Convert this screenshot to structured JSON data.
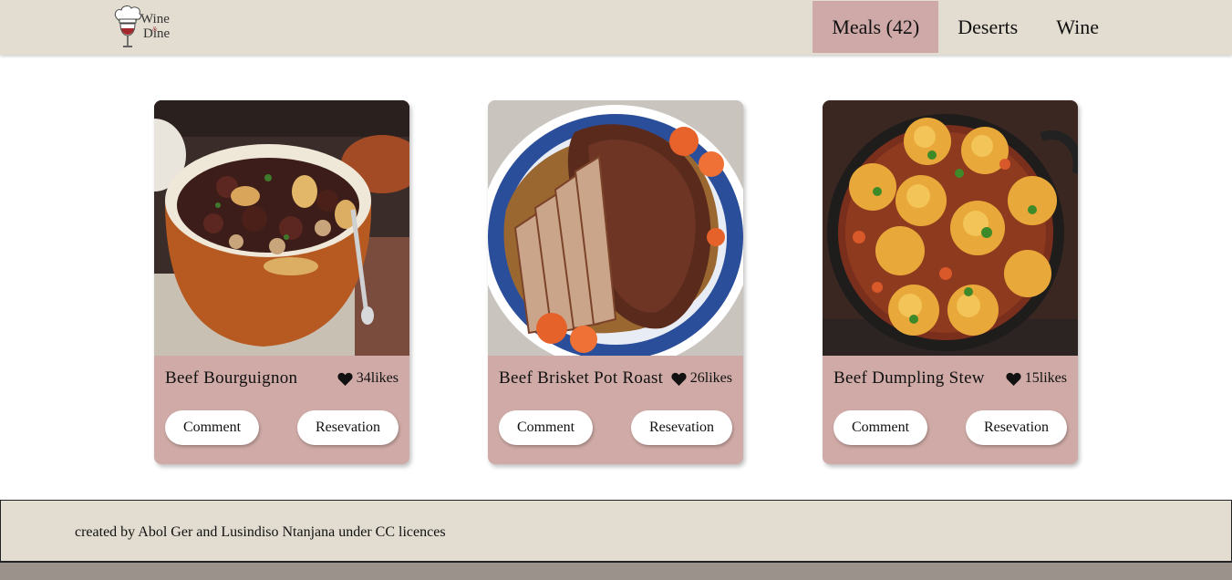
{
  "header": {
    "logo": {
      "line1": "Wine",
      "amp": "&",
      "line2": "Dine"
    },
    "nav": [
      {
        "label": "Meals (42)",
        "active": true
      },
      {
        "label": "Deserts",
        "active": false
      },
      {
        "label": "Wine",
        "active": false
      }
    ]
  },
  "meals": [
    {
      "title": "Beef Bourguignon",
      "likes": "34likes",
      "comment_label": "Comment",
      "reservation_label": "Resevation",
      "image": "beef-bourguignon-photo"
    },
    {
      "title": "Beef Brisket Pot Roast",
      "likes": "26likes",
      "comment_label": "Comment",
      "reservation_label": "Resevation",
      "image": "beef-brisket-photo"
    },
    {
      "title": "Beef Dumpling Stew",
      "likes": "15likes",
      "comment_label": "Comment",
      "reservation_label": "Resevation",
      "image": "beef-dumpling-stew-photo"
    }
  ],
  "footer": {
    "text": "created by Abol Ger and Lusindiso Ntanjana under CC licences"
  },
  "colors": {
    "header_bg": "#e3ddd1",
    "accent": "#cea9a7",
    "card_bg": "#cfaaa6",
    "bottom_bar": "#9b938b"
  },
  "icons": {
    "like": "heart-icon",
    "logo": "chef-wine-logo"
  }
}
